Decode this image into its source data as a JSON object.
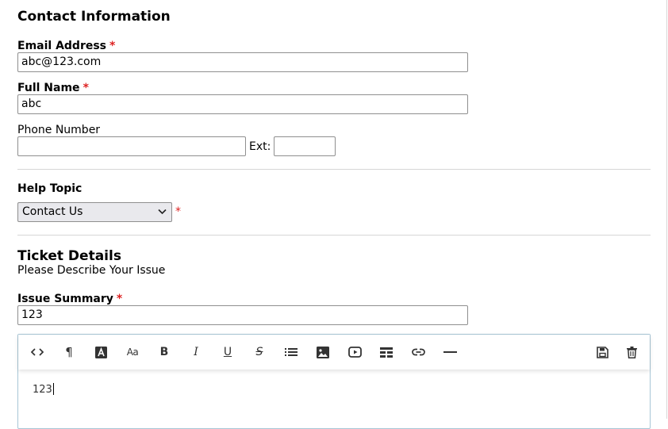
{
  "contact": {
    "title": "Contact Information",
    "email_label": "Email Address",
    "email_value": "abc@123.com",
    "fullname_label": "Full Name",
    "fullname_value": "abc",
    "phone_label": "Phone Number",
    "phone_value": "",
    "ext_label": "Ext:",
    "ext_value": "",
    "required_mark": "*"
  },
  "help_topic": {
    "label": "Help Topic",
    "selected": "Contact Us",
    "required_mark": "*"
  },
  "ticket": {
    "title": "Ticket Details",
    "subtitle": "Please Describe Your Issue",
    "summary_label": "Issue Summary",
    "summary_value": "123",
    "required_mark": "*"
  },
  "editor": {
    "toolbar": [
      "code-view-icon",
      "paragraph-format-icon",
      "text-color-icon",
      "font-size-icon",
      "bold-icon",
      "italic-icon",
      "underline-icon",
      "strikethrough-icon",
      "unordered-list-icon",
      "insert-image-icon",
      "insert-video-icon",
      "insert-table-icon",
      "insert-link-icon",
      "horizontal-rule-icon",
      "save-draft-icon",
      "delete-draft-icon"
    ],
    "bold_glyph": "B",
    "italic_glyph": "I",
    "underline_glyph": "U",
    "strike_glyph": "S",
    "font_size_glyph": "Aa",
    "paragraph_glyph": "¶",
    "content": "123"
  }
}
